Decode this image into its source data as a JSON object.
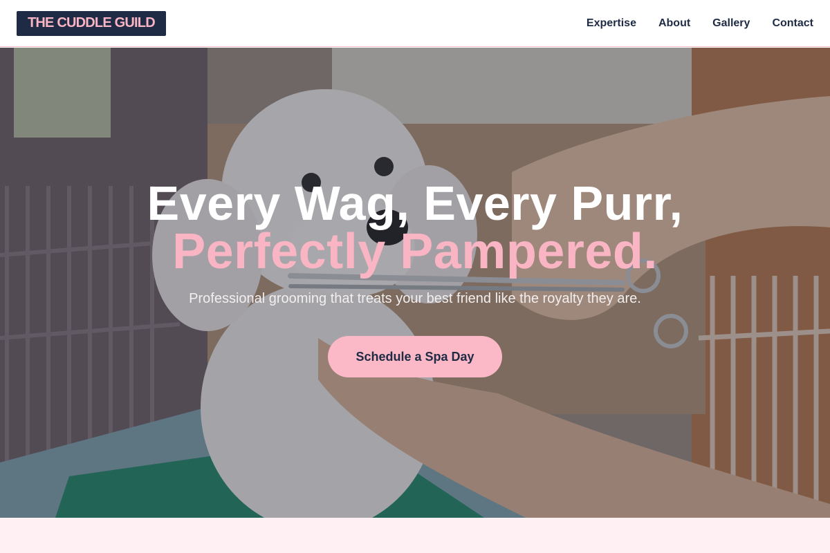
{
  "header": {
    "logo_text": "THE CUDDLE GUILD",
    "nav": [
      {
        "label": "Expertise"
      },
      {
        "label": "About"
      },
      {
        "label": "Gallery"
      },
      {
        "label": "Contact"
      }
    ]
  },
  "hero": {
    "headline_line1": "Every Wag, Every Purr,",
    "headline_line2": "Perfectly Pampered.",
    "subtitle": "Professional grooming that treats your best friend like the royalty they are.",
    "cta_label": "Schedule a Spa Day",
    "background_image": "white-poodle-being-groomed-with-scissors"
  },
  "colors": {
    "brand_navy": "#1f2a44",
    "brand_pink": "#f9b5c3",
    "section_blush": "#fff0f4"
  }
}
